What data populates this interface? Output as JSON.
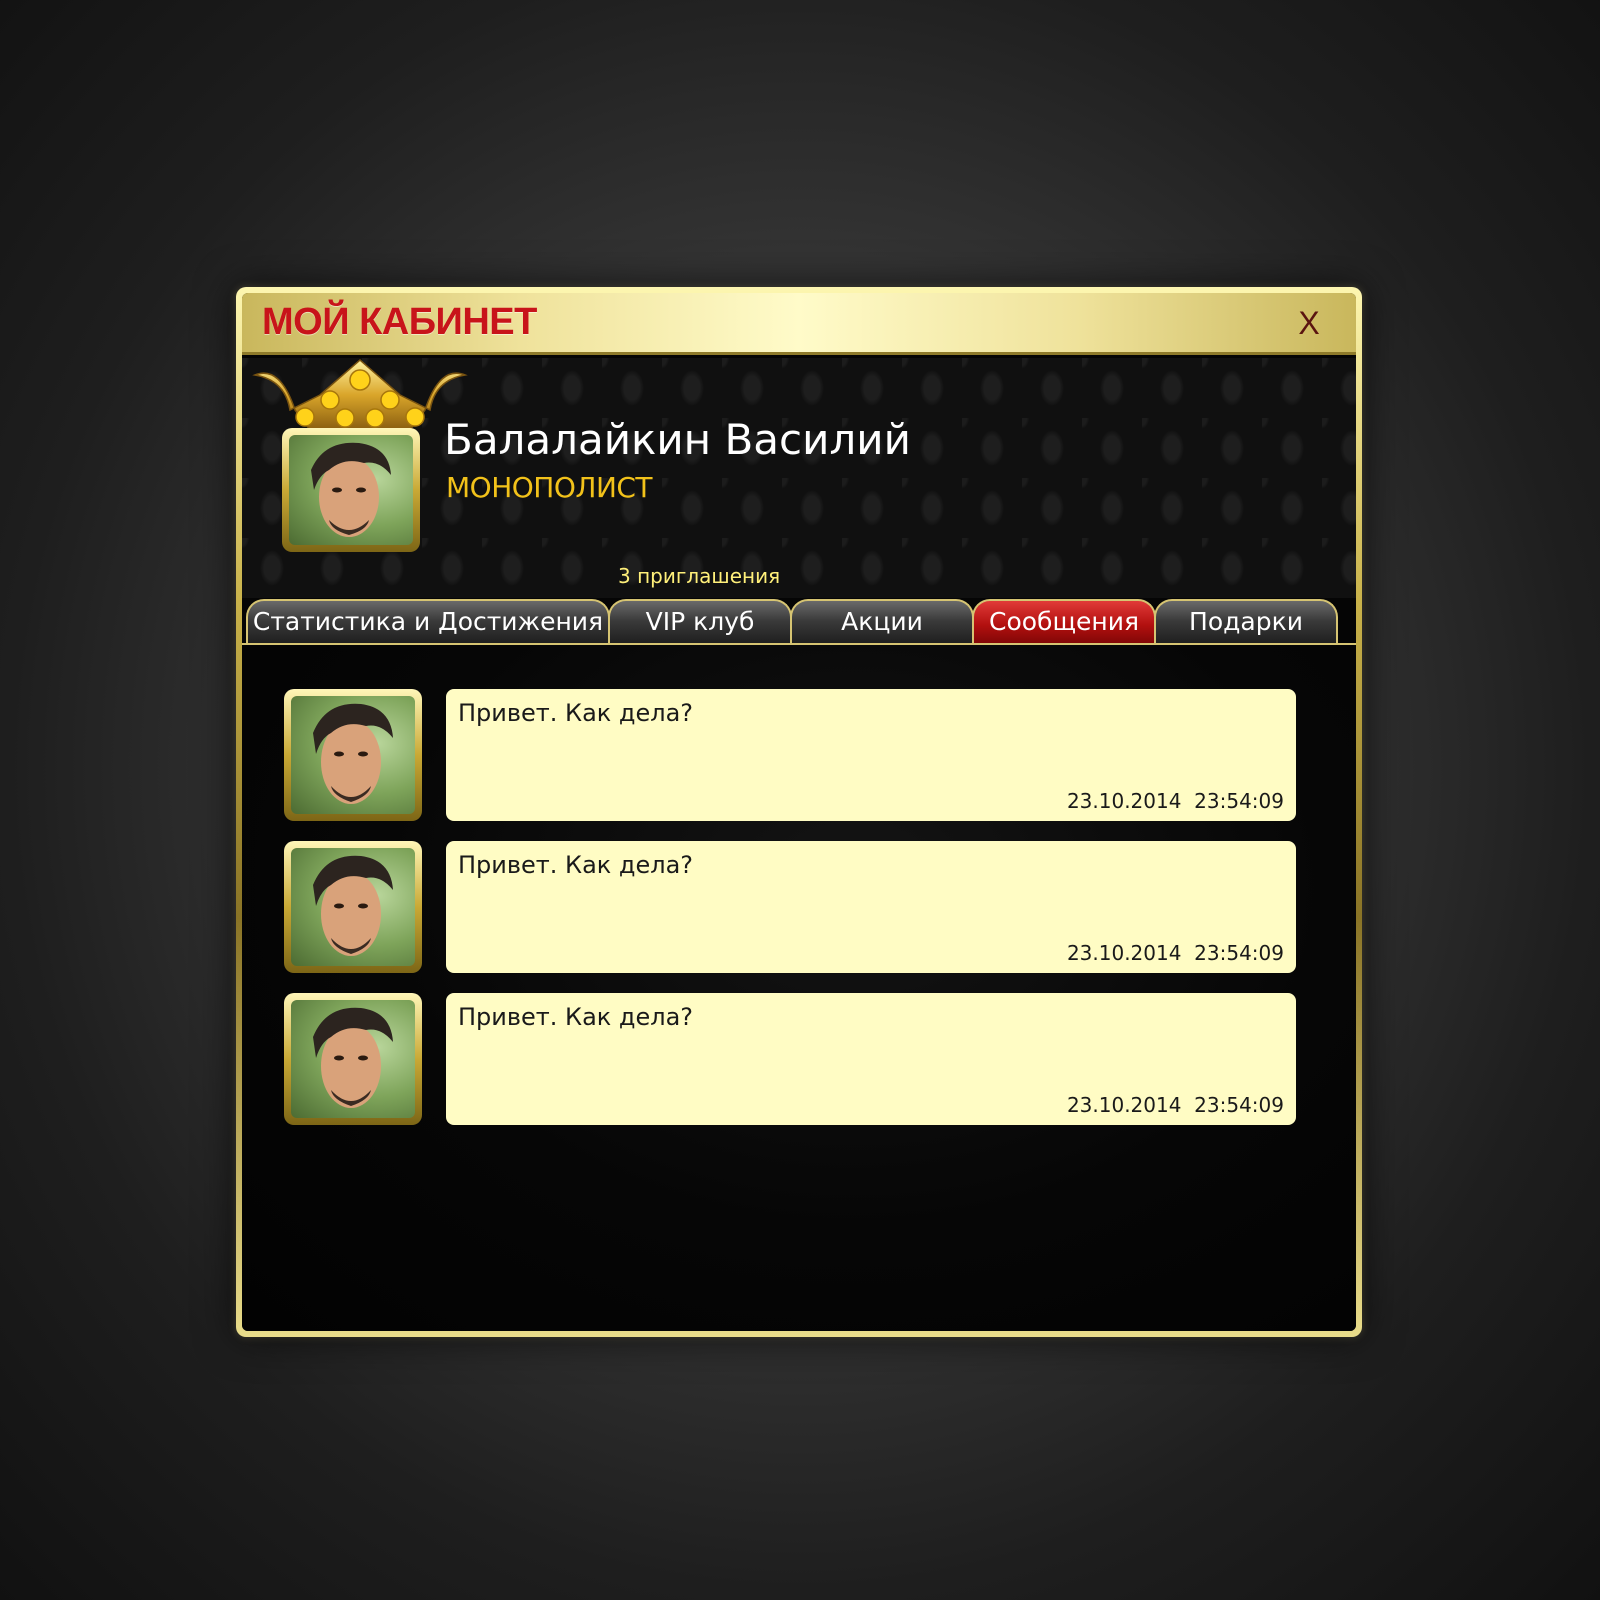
{
  "window": {
    "title": "МОЙ КАБИНЕТ",
    "close_label": "X"
  },
  "profile": {
    "name": "Балалайкин Василий",
    "rank": "МОНОПОЛИСТ",
    "avatar": "user-photo"
  },
  "invites_label": "3 приглашения",
  "tabs": [
    {
      "label": "Статистика и Достижения",
      "active": false
    },
    {
      "label": "VIP клуб",
      "active": false
    },
    {
      "label": "Акции",
      "active": false
    },
    {
      "label": "Сообщения",
      "active": true
    },
    {
      "label": "Подарки",
      "active": false
    }
  ],
  "messages": [
    {
      "text": "Привет. Как дела?",
      "date": "23.10.2014",
      "time": "23:54:09"
    },
    {
      "text": "Привет. Как дела?",
      "date": "23.10.2014",
      "time": "23:54:09"
    },
    {
      "text": "Привет. Как дела?",
      "date": "23.10.2014",
      "time": "23:54:09"
    }
  ],
  "colors": {
    "title": "#c8141a",
    "rank": "#f2c21a",
    "invites": "#fff07a",
    "active_tab": "#b2100f",
    "bubble": "#fffcc4",
    "frame_gold": "#d6c472"
  }
}
